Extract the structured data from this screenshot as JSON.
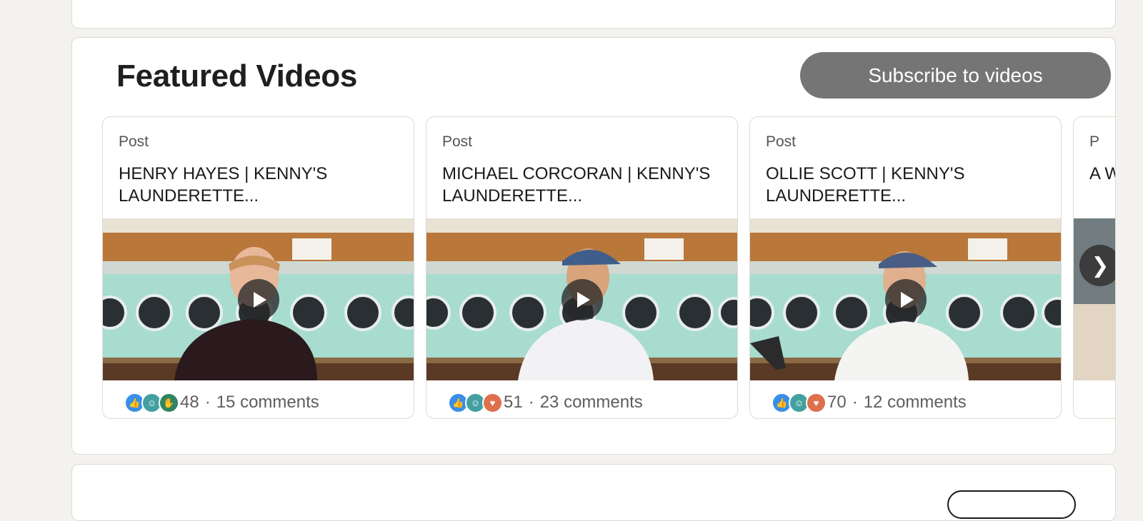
{
  "section": {
    "title": "Featured Videos",
    "subscribe_label": "Subscribe to videos"
  },
  "cards": [
    {
      "type": "Post",
      "title": "HENRY HAYES | KENNY'S LAUNDERETTE...",
      "reaction_count": "48",
      "separator": "·",
      "comments": "15 comments",
      "reactions": [
        "like-icon",
        "celebrate-icon",
        "support-icon"
      ]
    },
    {
      "type": "Post",
      "title": "MICHAEL CORCORAN | KENNY'S LAUNDERETTE...",
      "reaction_count": "51",
      "separator": "·",
      "comments": "23 comments",
      "reactions": [
        "like-icon",
        "celebrate-icon",
        "love-icon"
      ]
    },
    {
      "type": "Post",
      "title": "OLLIE SCOTT | KENNY'S LAUNDERETTE...",
      "reaction_count": "70",
      "separator": "·",
      "comments": "12 comments",
      "reactions": [
        "like-icon",
        "celebrate-icon",
        "love-icon"
      ]
    },
    {
      "type": "P",
      "title": "A W"
    }
  ],
  "carousel": {
    "next_glyph": "❯"
  },
  "colors": {
    "page_bg": "#f3f2ef",
    "subscribe_bg": "#757575",
    "washer_teal": "#a8dccf",
    "wood_ceiling": "#b9773a"
  }
}
